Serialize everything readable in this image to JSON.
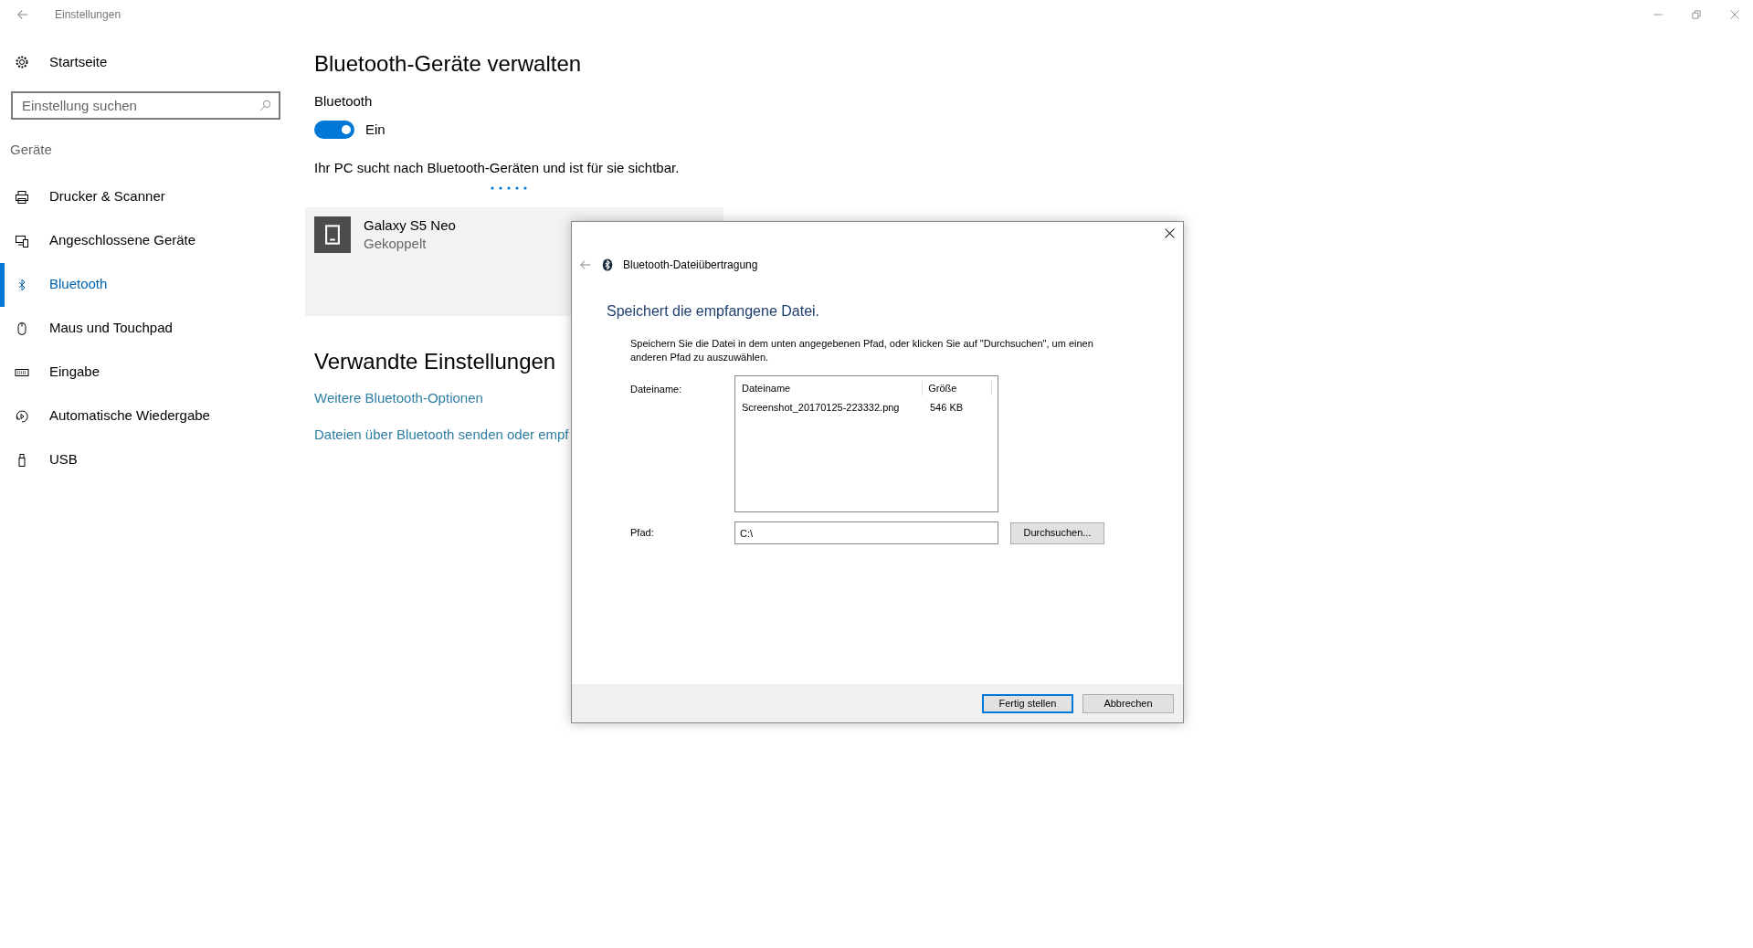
{
  "window": {
    "title": "Einstellungen"
  },
  "sidebar": {
    "home": "Startseite",
    "search": {
      "placeholder": "Einstellung suchen"
    },
    "section": "Geräte",
    "items": [
      {
        "label": "Drucker & Scanner",
        "selected": false
      },
      {
        "label": "Angeschlossene Geräte",
        "selected": false
      },
      {
        "label": "Bluetooth",
        "selected": true
      },
      {
        "label": "Maus und Touchpad",
        "selected": false
      },
      {
        "label": "Eingabe",
        "selected": false
      },
      {
        "label": "Automatische Wiedergabe",
        "selected": false
      },
      {
        "label": "USB",
        "selected": false
      }
    ]
  },
  "main": {
    "title": "Bluetooth-Geräte verwalten",
    "bluetooth": {
      "label": "Bluetooth",
      "on": true,
      "state_text": "Ein"
    },
    "status": "Ihr PC sucht nach Bluetooth-Geräten und ist für sie sichtbar.",
    "devices": [
      {
        "name": "Galaxy S5 Neo",
        "status": "Gekoppelt"
      }
    ],
    "related": {
      "title": "Verwandte Einstellungen",
      "links": [
        "Weitere Bluetooth-Optionen",
        "Dateien über Bluetooth senden oder empf"
      ]
    }
  },
  "dialog": {
    "title": "Bluetooth-Dateiübertragung",
    "heading": "Speichert die empfangene Datei.",
    "description": "Speichern Sie die Datei in dem unten angegebenen Pfad, oder klicken Sie auf \"Durchsuchen\", um einen anderen Pfad zu auszuwählen.",
    "filename_label": "Dateiname:",
    "list": {
      "columns": [
        "Dateiname",
        "Größe"
      ],
      "rows": [
        {
          "cells": [
            "Screenshot_20170125-223332.png",
            "546 KB"
          ]
        }
      ]
    },
    "path_label": "Pfad:",
    "path_value": "C:\\",
    "browse_button": "Durchsuchen...",
    "buttons": [
      {
        "label": "Fertig stellen",
        "default": true
      },
      {
        "label": "Abbrechen",
        "default": false
      }
    ]
  }
}
